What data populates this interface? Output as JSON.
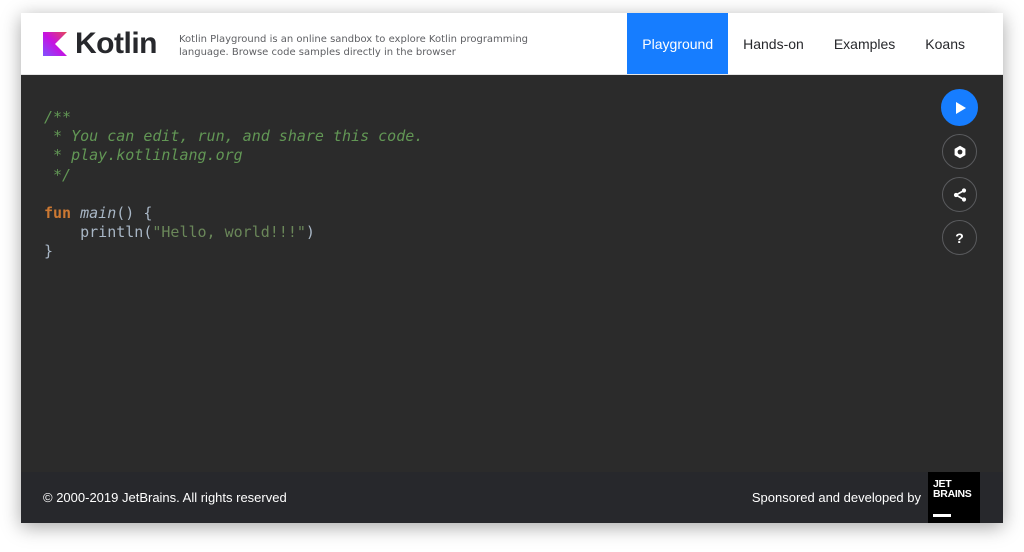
{
  "header": {
    "logo_text": "Kotlin",
    "tagline": "Kotlin Playground is an online sandbox to explore Kotlin programming language. Browse code samples directly in the browser",
    "nav": [
      {
        "label": "Playground",
        "active": true
      },
      {
        "label": "Hands-on",
        "active": false
      },
      {
        "label": "Examples",
        "active": false
      },
      {
        "label": "Koans",
        "active": false
      }
    ]
  },
  "editor": {
    "comment_lines": [
      "/**",
      " * You can edit, run, and share this code.",
      " * play.kotlinlang.org",
      " */"
    ],
    "keyword_fun": "fun",
    "function_name": "main",
    "signature_rest": "() {",
    "call_indent": "    ",
    "call_name": "println",
    "call_open": "(",
    "string_literal": "\"Hello, world!!!\"",
    "call_close": ")",
    "closing_brace": "}",
    "side_buttons": [
      "play-icon",
      "settings-icon",
      "share-icon",
      "help-icon"
    ],
    "help_glyph": "?"
  },
  "footer": {
    "copyright": "© 2000-2019 JetBrains. All rights reserved",
    "sponsor": "Sponsored and developed by",
    "jetbrains_logo_line1": "JET",
    "jetbrains_logo_line2": "BRAINS"
  },
  "colors": {
    "accent": "#167dff",
    "editor_bg": "#2b2b2b",
    "footer_bg": "#27282c",
    "comment": "#629755",
    "keyword": "#cc7832",
    "string": "#6a8759"
  }
}
